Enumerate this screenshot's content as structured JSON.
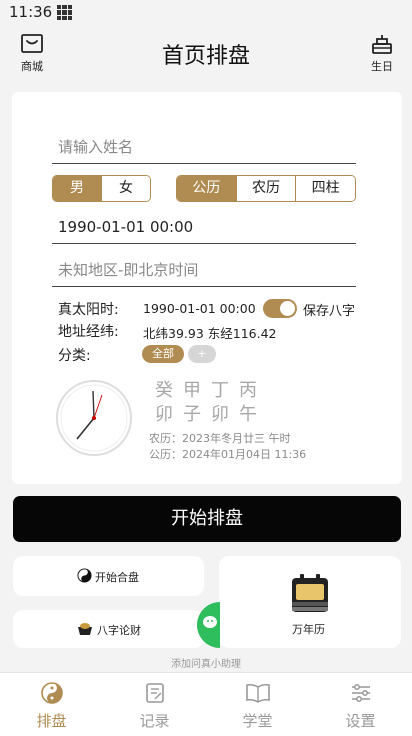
{
  "status_bar": {
    "time": "11:36"
  },
  "header": {
    "title": "首页排盘",
    "left_label": "商城",
    "right_label": "生日"
  },
  "form": {
    "name_placeholder": "请输入姓名",
    "gender_options": [
      "男",
      "女"
    ],
    "gender_selected": "男",
    "calendar_options": [
      "公历",
      "农历",
      "四柱"
    ],
    "calendar_selected": "公历",
    "datetime_value": "1990-01-01 00:00",
    "location_placeholder": "未知地区-即北京时间",
    "true_solar_label": "真太阳时:",
    "true_solar_value": "1990-01-01 00:00",
    "save_bazi_label": "保存八字",
    "save_bazi_on": true,
    "coords_label": "地址经纬:",
    "coords_value": "北纬39.93 东经116.42",
    "category_label": "分类:",
    "category_chip": "全部",
    "category_add": "+"
  },
  "bazi": {
    "stems": "癸甲丁丙",
    "branches": "卯子卯午",
    "lunar_line": "农历：2023年冬月廿三 午时",
    "solar_line": "公历：2024年01月04日 11:36"
  },
  "start_button": "开始排盘",
  "quick_cards": {
    "hepan": "开始合盘",
    "lucai": "八字论财",
    "calendar": "万年历"
  },
  "assistant_tip": "添加问真小助理",
  "tabs": [
    {
      "label": "排盘",
      "icon": "yin-yang-icon",
      "active": true
    },
    {
      "label": "记录",
      "icon": "notebook-icon",
      "active": false
    },
    {
      "label": "学堂",
      "icon": "book-icon",
      "active": false
    },
    {
      "label": "设置",
      "icon": "sliders-icon",
      "active": false
    }
  ],
  "colors": {
    "accent": "#b08c52",
    "button": "#060606",
    "background": "#f3f3f3"
  }
}
